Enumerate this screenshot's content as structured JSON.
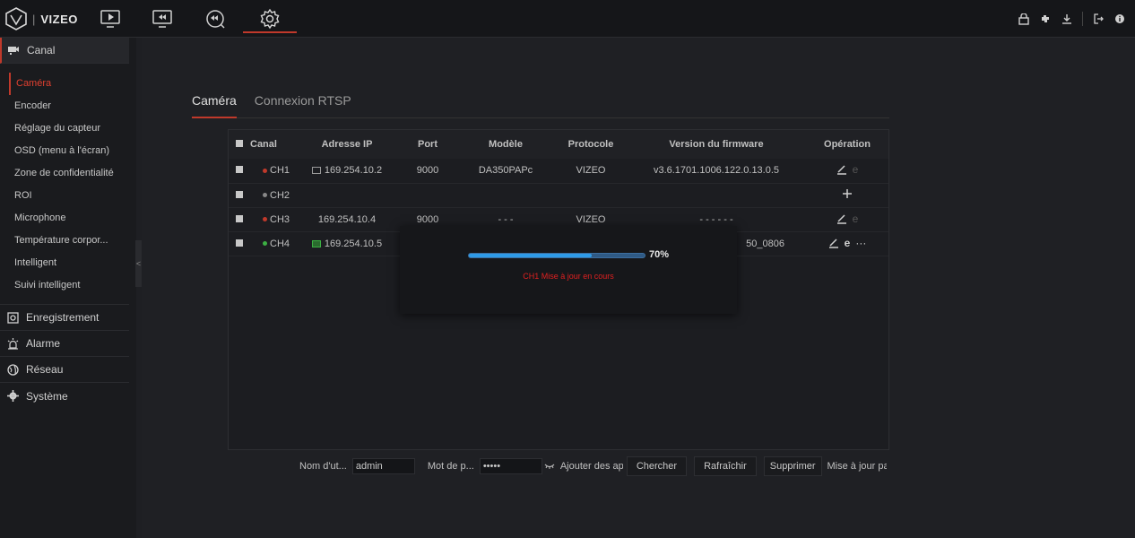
{
  "app": {
    "logo_text": "VIZEO",
    "logo_sep": "|"
  },
  "topnav": [
    "play-icon",
    "playback-icon",
    "rewind-icon",
    "settings-icon"
  ],
  "sidebar": {
    "groups": [
      {
        "label": "Canal",
        "icon": "camera-icon"
      },
      {
        "label": "Enregistrement",
        "icon": "record-icon"
      },
      {
        "label": "Alarme",
        "icon": "alarm-icon"
      },
      {
        "label": "Réseau",
        "icon": "globe-icon"
      },
      {
        "label": "Système",
        "icon": "gear-icon"
      }
    ],
    "items": [
      {
        "label": "Caméra"
      },
      {
        "label": "Encoder"
      },
      {
        "label": "Réglage du capteur"
      },
      {
        "label": "OSD (menu à l'écran)"
      },
      {
        "label": "Zone de confidentialité"
      },
      {
        "label": "ROI"
      },
      {
        "label": "Microphone"
      },
      {
        "label": "Température corpor..."
      },
      {
        "label": "Intelligent"
      },
      {
        "label": "Suivi intelligent"
      }
    ],
    "collapse": "<"
  },
  "tabs": [
    {
      "label": "Caméra"
    },
    {
      "label": "Connexion RTSP"
    }
  ],
  "table": {
    "headers": [
      "Canal",
      "Adresse IP",
      "Port",
      "Modèle",
      "Protocole",
      "Version du firmware",
      "Opération"
    ],
    "rows": [
      {
        "channel": "CH1",
        "ip": "169.254.10.2",
        "port": "9000",
        "model": "DA350PAPc",
        "protocol": "VIZEO",
        "firmware": "v3.6.1701.1006.122.0.13.0.5"
      },
      {
        "channel": "CH2",
        "ip": "",
        "port": "",
        "model": "",
        "protocol": "",
        "firmware": ""
      },
      {
        "channel": "CH3",
        "ip": "169.254.10.4",
        "port": "9000",
        "model": "- - -",
        "protocol": "VIZEO",
        "firmware": "- - - - - -"
      },
      {
        "channel": "CH4",
        "ip": "169.254.10.5",
        "port": "",
        "model": "",
        "protocol": "",
        "firmware": "50_0806"
      }
    ],
    "status_colors": {
      "offline": "#c0392b",
      "empty": "#888888",
      "online": "#3cb043"
    }
  },
  "modal": {
    "progress": 0.7,
    "percent_label": "70%",
    "message": "CH1 Mise à jour en cours"
  },
  "bottom": {
    "user_label": "Nom d'ut...",
    "user_value": "admin",
    "pass_label": "Mot de p...",
    "pass_value": "•••••",
    "add_label": "Ajouter des ap",
    "search_btn": "Chercher",
    "refresh_btn": "Rafraîchir",
    "delete_btn": "Supprimer",
    "update_label": "Mise à jour pa"
  }
}
